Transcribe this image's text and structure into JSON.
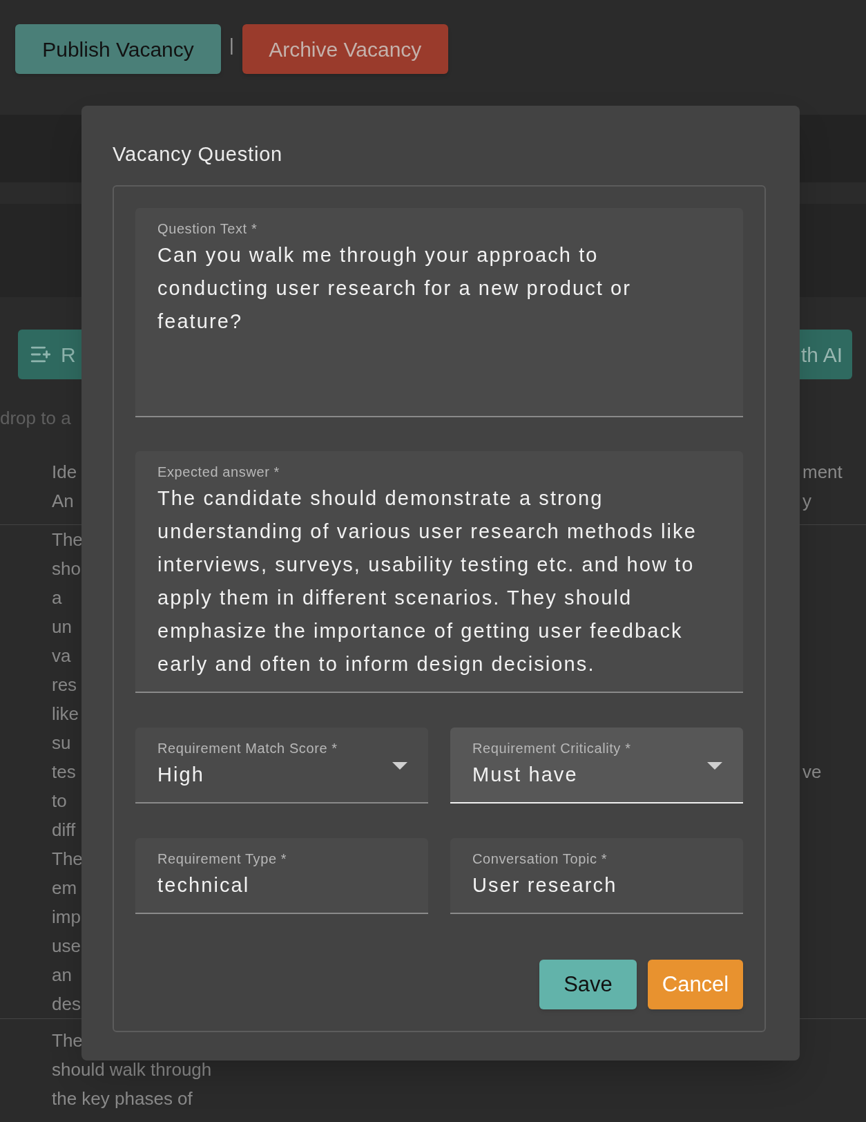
{
  "toolbar": {
    "buttons": [
      {
        "label": "Publish Vacancy",
        "kind": "publish"
      },
      {
        "label": "Archive Vacancy",
        "kind": "archive"
      }
    ],
    "separator": "|"
  },
  "background": {
    "left_button": "R",
    "right_button": "th AI",
    "hint": "drop to a",
    "table": {
      "header_column_1": [
        "Ide",
        "An"
      ],
      "header_column_2": [
        "ment",
        "y"
      ],
      "rows": [
        {
          "column_1": [
            "The",
            "sho",
            "a",
            "un",
            "va",
            "res",
            "like",
            "su",
            "tes",
            "to",
            "diff",
            "The",
            "em",
            "imp",
            "use",
            "an",
            "des"
          ],
          "column_2": "ve"
        },
        {
          "column_1": [
            "The",
            "should walk through",
            "the key phases of"
          ]
        }
      ]
    }
  },
  "dialog": {
    "title": "Vacancy Question",
    "fields": [
      {
        "kind": "textarea",
        "label": "Question Text *",
        "value": "Can you walk me through your approach to conducting user research for a new product or feature?",
        "focused": false
      },
      {
        "kind": "textarea",
        "label": "Expected answer *",
        "value": "The candidate should demonstrate a strong understanding of various user research methods like interviews, surveys, usability testing etc. and how to apply them in different scenarios. They should emphasize the importance of getting user feedback early and often to inform design decisions.",
        "focused": false
      },
      {
        "kind": "select",
        "label": "Requirement Match Score *",
        "value": "High",
        "focused": false
      },
      {
        "kind": "select",
        "label": "Requirement Criticality *",
        "value": "Must have",
        "focused": true
      },
      {
        "kind": "text",
        "label": "Requirement Type *",
        "value": "technical",
        "focused": false
      },
      {
        "kind": "text",
        "label": "Conversation Topic *",
        "value": "User research",
        "focused": false
      }
    ],
    "buttons": [
      {
        "label": "Save",
        "kind": "save"
      },
      {
        "label": "Cancel",
        "kind": "cancel"
      }
    ]
  }
}
